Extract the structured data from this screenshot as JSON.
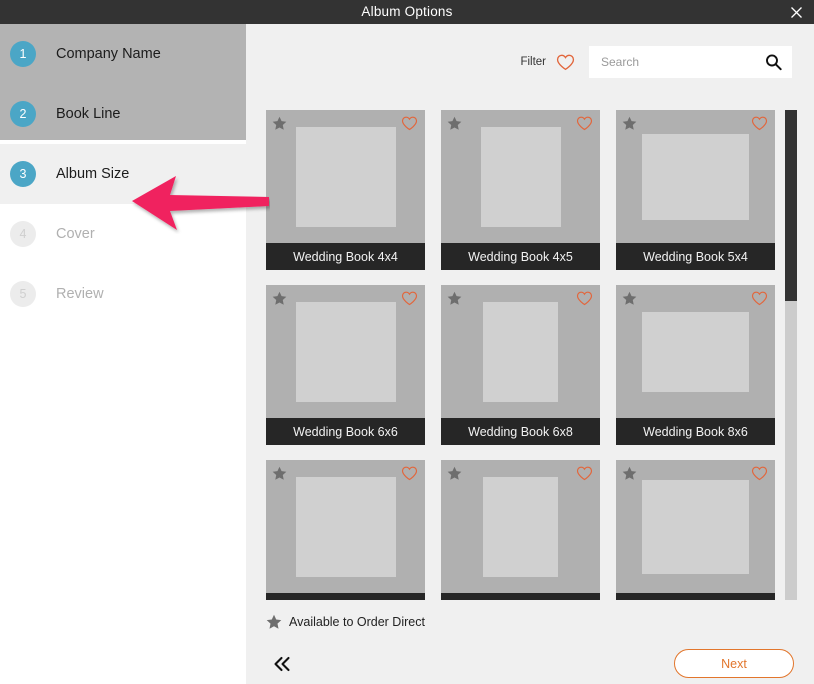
{
  "window": {
    "title": "Album Options",
    "close_label": "×",
    "close_icon": "close-icon"
  },
  "sidebar": {
    "steps": [
      {
        "number": "1",
        "label": "Company Name",
        "state": "completed"
      },
      {
        "number": "2",
        "label": "Book Line",
        "state": "completed"
      },
      {
        "number": "3",
        "label": "Album Size",
        "state": "active"
      },
      {
        "number": "4",
        "label": "Cover",
        "state": "disabled"
      },
      {
        "number": "5",
        "label": "Review",
        "state": "disabled"
      }
    ],
    "active_step_number": "3",
    "step_circle_color": "#4ba6c6",
    "completed_band_color": "#b3b3b3",
    "active_row_color": "#f0f0f0"
  },
  "annotation": {
    "type": "arrow",
    "points_to": "Album Size",
    "color": "#f0225e"
  },
  "toolbar": {
    "filter_label": "Filter",
    "filter_heart_icon": "heart-outline-icon",
    "filter_heart_color": "#e2663c",
    "search_placeholder": "Search",
    "search_value": "",
    "search_icon": "search-icon"
  },
  "grid": {
    "cards": [
      {
        "label": "Wedding Book 4x4",
        "width": 4,
        "height": 4,
        "starred": true,
        "favorited": false
      },
      {
        "label": "Wedding Book 4x5",
        "width": 4,
        "height": 5,
        "starred": true,
        "favorited": false
      },
      {
        "label": "Wedding Book 5x4",
        "width": 5,
        "height": 4,
        "starred": true,
        "favorited": false
      },
      {
        "label": "Wedding Book 6x6",
        "width": 6,
        "height": 6,
        "starred": true,
        "favorited": false
      },
      {
        "label": "Wedding Book 6x8",
        "width": 6,
        "height": 8,
        "starred": true,
        "favorited": false
      },
      {
        "label": "Wedding Book 8x6",
        "width": 8,
        "height": 6,
        "starred": true,
        "favorited": false
      },
      {
        "label": "",
        "width": 6,
        "height": 6,
        "starred": true,
        "favorited": false
      },
      {
        "label": "",
        "width": 6,
        "height": 8,
        "starred": true,
        "favorited": false
      },
      {
        "label": "",
        "width": 8,
        "height": 7,
        "starred": true,
        "favorited": false
      }
    ],
    "star_icon": "star-icon",
    "heart_icon": "heart-outline-icon"
  },
  "scrollbar": {
    "orientation": "vertical",
    "thumb_position_percent": 0,
    "thumb_size_percent": 39
  },
  "legend": {
    "star_icon": "star-icon",
    "text": "Available to Order Direct"
  },
  "footer": {
    "back_label": "«",
    "back_icon": "double-chevron-left-icon",
    "next_label": "Next",
    "next_color": "#e2762c"
  }
}
